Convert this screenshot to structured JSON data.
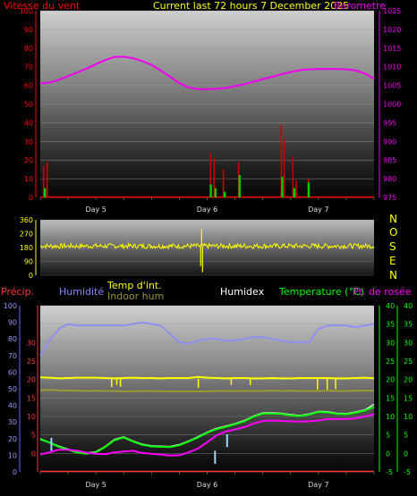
{
  "header": {
    "wind_speed_label": "Vitesse du vent",
    "title": "Current last 72 hours 7 December 2025",
    "barometer_label": "Barometre"
  },
  "direction_labels": [
    "N",
    "O",
    "S",
    "E",
    "N"
  ],
  "bottom_header": {
    "precip_label": "Précip.",
    "humidity_label": "Humidité",
    "temp_int_label": "Temp d'int.",
    "indoor_hum_label": "Indoor hum",
    "humidex_label": "Humidex",
    "temperature_label": "Temperature (°C)",
    "dewpoint_label": "Pt. de rosée"
  },
  "colors": {
    "wind": "#ff0000",
    "wind_gust": "#cc0000",
    "wind_avg": "#00cc00",
    "barometer": "#ee00ee",
    "title": "#ffff00",
    "direction": "#ffff00",
    "precip": "#ff3333",
    "humidity": "#8888ff",
    "humidity_line": "#8f90f0",
    "temp_int": "#ffff00",
    "indoor_hum": "#999933",
    "humidex": "#ffffff",
    "temperature": "#00ff00",
    "dewpoint": "#ff00ff",
    "windchill": "#9ad9ff"
  },
  "chart_data": [
    {
      "type": "line",
      "name": "wind_barometer",
      "x_ticks": [
        "Day 5",
        "Day 6",
        "Day 7"
      ],
      "y_left_ticks": [
        "0",
        "10",
        "20",
        "30",
        "40",
        "50",
        "60",
        "70",
        "80",
        "90",
        "100"
      ],
      "y_left_range": [
        0,
        100
      ],
      "y_right_ticks": [
        "975",
        "980",
        "985",
        "990",
        "995",
        "1000",
        "1005",
        "1010",
        "1015",
        "1020",
        "1025"
      ],
      "y_right_range": [
        975,
        1025
      ],
      "barometer_hours": [
        0,
        2,
        4,
        6,
        8,
        10,
        12,
        14,
        16,
        18,
        20,
        22,
        24,
        26,
        28,
        30,
        32,
        34,
        36,
        38,
        40,
        42,
        44,
        46,
        48,
        50,
        52,
        54,
        56,
        58,
        60,
        62,
        64,
        66,
        68,
        70,
        72
      ],
      "barometer": [
        1005.5,
        1005.8,
        1006.5,
        1007.5,
        1008.5,
        1009.5,
        1010.7,
        1011.8,
        1012.6,
        1012.7,
        1012.3,
        1011.5,
        1010.5,
        1009.0,
        1007.3,
        1005.6,
        1004.5,
        1004.0,
        1004.0,
        1004.1,
        1004.3,
        1004.8,
        1005.3,
        1006.0,
        1006.7,
        1007.3,
        1008.0,
        1008.6,
        1009.1,
        1009.3,
        1009.4,
        1009.4,
        1009.4,
        1009.3,
        1009.0,
        1008.2,
        1006.8
      ],
      "wind_gust_spikes": [
        {
          "hour": 0.7,
          "value": 17
        },
        {
          "hour": 1.5,
          "value": 19
        },
        {
          "hour": 36.7,
          "value": 24
        },
        {
          "hour": 37.5,
          "value": 21
        },
        {
          "hour": 39.5,
          "value": 15
        },
        {
          "hour": 42.8,
          "value": 19
        },
        {
          "hour": 52.0,
          "value": 39
        },
        {
          "hour": 52.6,
          "value": 31
        },
        {
          "hour": 54.5,
          "value": 22
        },
        {
          "hour": 55.2,
          "value": 9
        },
        {
          "hour": 57.8,
          "value": 10
        }
      ],
      "wind_avg_spikes": [
        {
          "hour": 1.0,
          "value": 5
        },
        {
          "hour": 36.8,
          "value": 7
        },
        {
          "hour": 37.8,
          "value": 5
        },
        {
          "hour": 39.8,
          "value": 3
        },
        {
          "hour": 43.0,
          "value": 12
        },
        {
          "hour": 52.2,
          "value": 11
        },
        {
          "hour": 54.8,
          "value": 5
        },
        {
          "hour": 57.9,
          "value": 8
        }
      ]
    },
    {
      "type": "line",
      "name": "wind_direction",
      "y_ticks": [
        "0",
        "90",
        "180",
        "270",
        "360"
      ],
      "y_range": [
        0,
        360
      ],
      "mean_deg": 190,
      "jitter_deg": 16,
      "dropouts": [
        {
          "hour": 34.6,
          "value": 60
        },
        {
          "hour": 34.8,
          "value": 300
        },
        {
          "hour": 35.0,
          "value": 20
        }
      ]
    },
    {
      "type": "line",
      "name": "temperature_humidity",
      "x_ticks": [
        "Day 5",
        "Day 6",
        "Day 7"
      ],
      "y_precip_ticks": [
        "0",
        "10",
        "20",
        "30",
        "40",
        "50",
        "60",
        "70",
        "80",
        "90",
        "100"
      ],
      "y_precip_range": [
        0,
        100
      ],
      "y_inner_left_ticks": [
        "0",
        "5",
        "10",
        "15",
        "20",
        "25",
        "30"
      ],
      "y_temp_ticks": [
        "-5",
        "0",
        "5",
        "10",
        "15",
        "20",
        "25",
        "30",
        "35",
        "40"
      ],
      "y_temp_range": [
        -5,
        40
      ],
      "hours": [
        0,
        2,
        4,
        6,
        8,
        10,
        12,
        14,
        16,
        18,
        20,
        22,
        24,
        26,
        28,
        30,
        32,
        34,
        36,
        38,
        40,
        42,
        44,
        46,
        48,
        50,
        52,
        54,
        56,
        58,
        60,
        62,
        64,
        66,
        68,
        70,
        72
      ],
      "humidity_percent": [
        70,
        79,
        86,
        89,
        88,
        88,
        88,
        88,
        88,
        88,
        89,
        90,
        89,
        88,
        83,
        78,
        77,
        79,
        80,
        80,
        79,
        79,
        80,
        81,
        81,
        80,
        79,
        78,
        78,
        78,
        86,
        88,
        88,
        88,
        87,
        88,
        89
      ],
      "temp_int": [
        20.6,
        20.5,
        20.3,
        20.4,
        20.5,
        20.5,
        20.5,
        20.4,
        20.3,
        20.4,
        20.5,
        20.4,
        20.4,
        20.3,
        20.4,
        20.4,
        20.4,
        20.7,
        20.5,
        20.4,
        20.3,
        20.4,
        20.4,
        20.3,
        20.3,
        20.4,
        20.3,
        20.3,
        20.4,
        20.4,
        20.4,
        20.4,
        20.3,
        20.3,
        20.4,
        20.5,
        20.3
      ],
      "indoor_hum": [
        17.1,
        17.2,
        17.1,
        17.0,
        17.0,
        16.9,
        17.0,
        16.9,
        16.9,
        16.8,
        16.8,
        16.9,
        16.9,
        16.8,
        16.8,
        16.8,
        16.8,
        16.8,
        16.8,
        16.9,
        16.9,
        16.9,
        16.9,
        16.9,
        16.9,
        17.0,
        16.9,
        17.0,
        16.9,
        16.9,
        16.9,
        17.0,
        16.9,
        16.9,
        17.0,
        17.0,
        17.0
      ],
      "temperature": [
        3.8,
        2.9,
        1.8,
        1.0,
        0.2,
        -0.1,
        0.3,
        1.7,
        3.6,
        4.3,
        3.2,
        2.3,
        1.9,
        1.8,
        1.7,
        2.2,
        3.2,
        4.3,
        5.6,
        6.6,
        7.2,
        7.9,
        8.7,
        9.9,
        10.8,
        10.8,
        10.7,
        10.3,
        10.1,
        10.5,
        11.2,
        11.1,
        10.7,
        10.6,
        11.0,
        11.6,
        12.6
      ],
      "dewpoint": [
        -0.3,
        0.3,
        1.0,
        1.0,
        0.7,
        0.2,
        -0.1,
        -0.2,
        0.3,
        0.5,
        0.7,
        0.1,
        -0.1,
        -0.3,
        -0.6,
        -0.5,
        0.3,
        1.3,
        3.0,
        4.9,
        5.9,
        6.5,
        7.1,
        8.1,
        8.8,
        8.9,
        8.8,
        8.7,
        8.6,
        8.7,
        8.9,
        9.3,
        9.3,
        9.3,
        9.5,
        10.0,
        10.6
      ],
      "humidex": [
        4.0,
        3.0,
        2.0,
        1.2,
        0.4,
        0.1,
        0.5,
        1.9,
        3.8,
        4.5,
        3.4,
        2.5,
        2.1,
        2.0,
        1.9,
        2.4,
        3.4,
        4.5,
        5.8,
        6.8,
        7.4,
        8.1,
        8.9,
        10.1,
        11.0,
        11.0,
        10.9,
        10.5,
        10.3,
        10.7,
        11.4,
        11.3,
        10.9,
        10.8,
        11.2,
        11.8,
        13.3
      ],
      "windchill_dips": [
        {
          "hour": 2.4,
          "value": 0.7
        },
        {
          "hour": 37.7,
          "value": -2.8
        },
        {
          "hour": 40.3,
          "value": 1.7
        }
      ],
      "temp_int_dips": [
        {
          "hour": 15.4,
          "value": 18.0
        },
        {
          "hour": 16.5,
          "value": 18.6
        },
        {
          "hour": 17.3,
          "value": 18.0
        },
        {
          "hour": 34.1,
          "value": 17.7
        },
        {
          "hour": 41.2,
          "value": 18.5
        },
        {
          "hour": 45.3,
          "value": 18.5
        },
        {
          "hour": 59.8,
          "value": 17.3
        },
        {
          "hour": 61.9,
          "value": 17.3
        },
        {
          "hour": 63.7,
          "value": 17.4
        }
      ],
      "precip_mm": [
        0
      ]
    }
  ]
}
